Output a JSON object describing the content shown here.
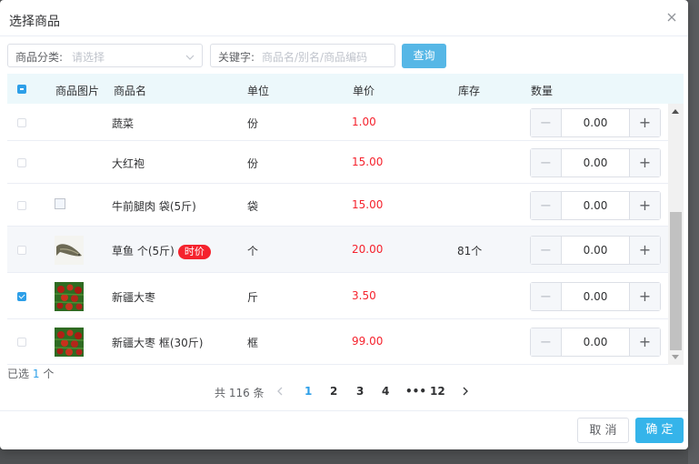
{
  "dialog": {
    "title": "选择商品"
  },
  "filters": {
    "category_label": "商品分类:",
    "category_placeholder": "请选择",
    "keyword_label": "关键字:",
    "keyword_placeholder": "商品名/别名/商品编码",
    "search_label": "查询"
  },
  "table": {
    "headers": {
      "image": "商品图片",
      "name": "商品名",
      "unit": "单位",
      "price": "单价",
      "stock": "库存",
      "qty": "数量"
    },
    "rows": [
      {
        "checked": false,
        "image": "none",
        "name": "蔬菜",
        "tag": "",
        "unit": "份",
        "price": "1.00",
        "stock": "",
        "qty": "0.00"
      },
      {
        "checked": false,
        "image": "none",
        "name": "大红袍",
        "tag": "",
        "unit": "份",
        "price": "15.00",
        "stock": "",
        "qty": "0.00"
      },
      {
        "checked": false,
        "image": "broken",
        "name": "牛前腿肉 袋(5斤)",
        "tag": "",
        "unit": "袋",
        "price": "15.00",
        "stock": "",
        "qty": "0.00"
      },
      {
        "checked": false,
        "image": "fish",
        "name": "草鱼 个(5斤)",
        "tag": "时价",
        "unit": "个",
        "price": "20.00",
        "stock": "81个",
        "qty": "0.00"
      },
      {
        "checked": true,
        "image": "dates",
        "name": "新疆大枣",
        "tag": "",
        "unit": "斤",
        "price": "3.50",
        "stock": "",
        "qty": "0.00"
      },
      {
        "checked": false,
        "image": "dates",
        "name": "新疆大枣 框(30斤)",
        "tag": "",
        "unit": "框",
        "price": "99.00",
        "stock": "",
        "qty": "0.00"
      }
    ]
  },
  "selection": {
    "prefix": "已选",
    "count": "1",
    "suffix": "个"
  },
  "pagination": {
    "total_text": "共 116 条",
    "pages": [
      "1",
      "2",
      "3",
      "4",
      "•••",
      "12"
    ],
    "current": "1"
  },
  "footer": {
    "cancel_label": "取 消",
    "confirm_label": "确 定"
  },
  "colors": {
    "accent": "#2d9fe8",
    "price": "#f5222d",
    "primary_button": "#35b4ea",
    "header_bg": "#ecf8fb"
  }
}
